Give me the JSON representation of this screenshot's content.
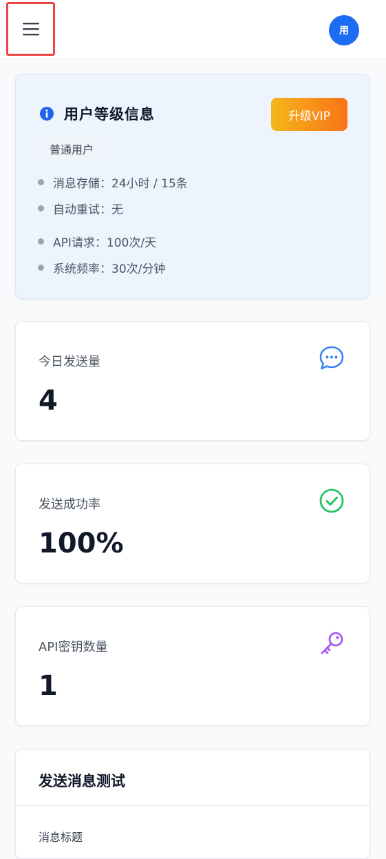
{
  "header": {
    "avatar_text": "用"
  },
  "level_card": {
    "title": "用户等级信息",
    "upgrade_label": "升级VIP",
    "badge": "普通用户",
    "features": [
      "消息存储：24小时 / 15条",
      "自动重试：无",
      "API请求：100次/天",
      "系统频率：30次/分钟"
    ]
  },
  "stats": [
    {
      "label": "今日发送量",
      "value": "4",
      "icon": "chat-icon",
      "color": "#3b82f6"
    },
    {
      "label": "发送成功率",
      "value": "100%",
      "icon": "check-circle-icon",
      "color": "#22c55e"
    },
    {
      "label": "API密钥数量",
      "value": "1",
      "icon": "key-icon",
      "color": "#a855f7"
    }
  ],
  "test_section": {
    "title": "发送消息测试",
    "subtitle": "消息标题"
  },
  "colors": {
    "primary": "#1d6df2",
    "upgrade_gradient_start": "#f5b61c",
    "upgrade_gradient_end": "#f97316",
    "highlight_border": "#ef4444"
  }
}
